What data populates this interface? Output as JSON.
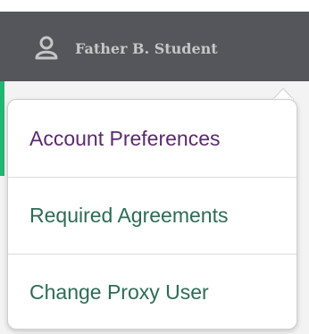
{
  "header": {
    "user_icon": "user-icon",
    "user_name": "Father B. Student"
  },
  "menu": {
    "items": [
      {
        "label": "Account Preferences"
      },
      {
        "label": "Required Agreements"
      },
      {
        "label": "Change Proxy User"
      }
    ]
  },
  "colors": {
    "header_bg": "#55565b",
    "accent_green": "#22b573",
    "item_primary": "#5b2a6e",
    "item_secondary": "#2e6b57"
  }
}
